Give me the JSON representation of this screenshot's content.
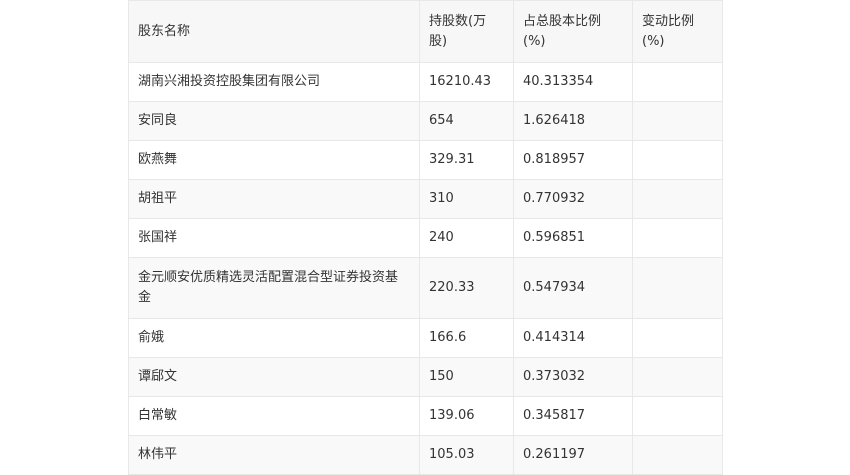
{
  "table": {
    "headers": [
      "股东名称",
      "持股数(万股)",
      "占总股本比例(%)",
      "变动比例(%)"
    ],
    "rows": [
      {
        "name": "湖南兴湘投资控股集团有限公司",
        "shares": "16210.43",
        "ratio": "40.313354",
        "change": ""
      },
      {
        "name": "安同良",
        "shares": "654",
        "ratio": "1.626418",
        "change": ""
      },
      {
        "name": "欧燕舞",
        "shares": "329.31",
        "ratio": "0.818957",
        "change": ""
      },
      {
        "name": "胡祖平",
        "shares": "310",
        "ratio": "0.770932",
        "change": ""
      },
      {
        "name": "张国祥",
        "shares": "240",
        "ratio": "0.596851",
        "change": ""
      },
      {
        "name": "金元顺安优质精选灵活配置混合型证券投资基金",
        "shares": "220.33",
        "ratio": "0.547934",
        "change": ""
      },
      {
        "name": "俞娥",
        "shares": "166.6",
        "ratio": "0.414314",
        "change": ""
      },
      {
        "name": "谭郈文",
        "shares": "150",
        "ratio": "0.373032",
        "change": ""
      },
      {
        "name": "白常敏",
        "shares": "139.06",
        "ratio": "0.345817",
        "change": ""
      },
      {
        "name": "林伟平",
        "shares": "105.03",
        "ratio": "0.261197",
        "change": ""
      }
    ]
  }
}
